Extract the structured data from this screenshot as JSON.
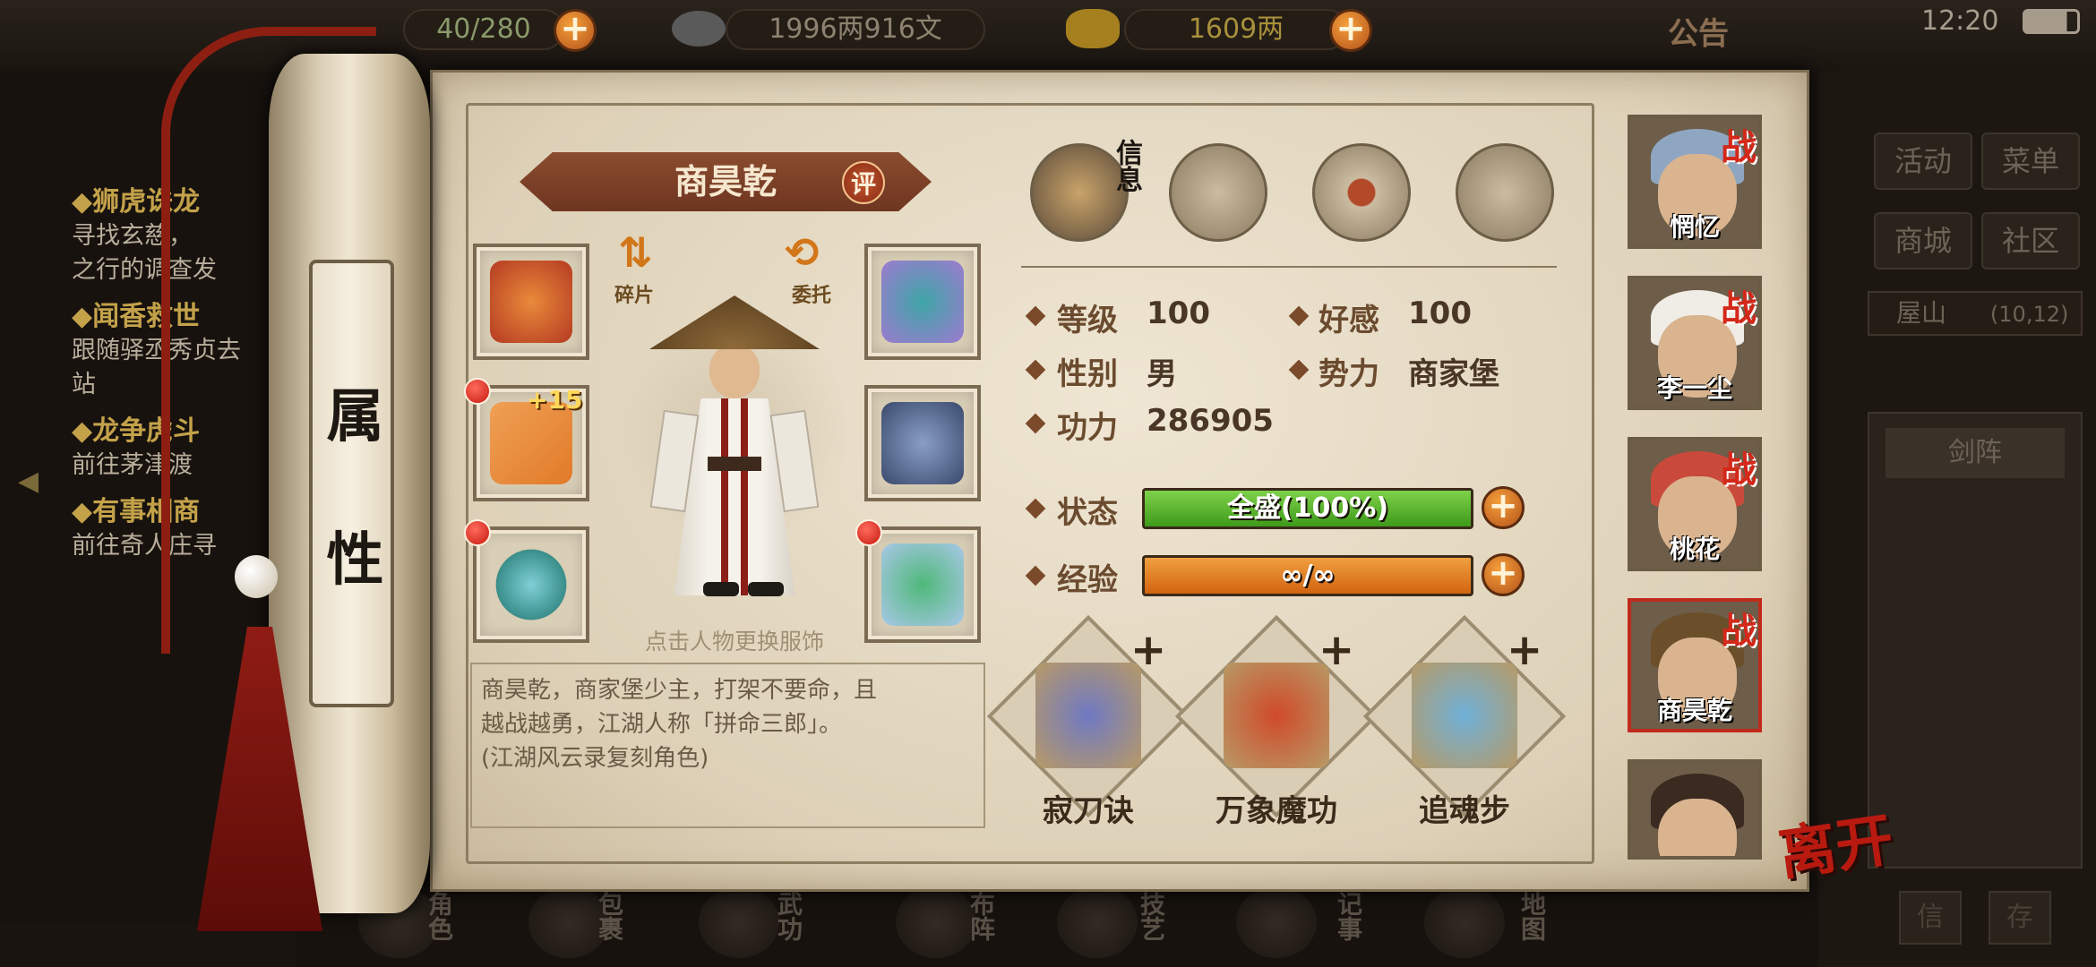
{
  "status_bar": {
    "time": "12:20"
  },
  "top_bar": {
    "resource1": "40/280",
    "silver": "1996两916文",
    "gold": "1609两",
    "notice": "公告"
  },
  "quests": [
    {
      "title": "◆狮虎诛龙",
      "desc": [
        "寻找玄慈，",
        "之行的调查发"
      ]
    },
    {
      "title": "◆闻香救世",
      "desc": [
        "跟随驿丞秀贞去",
        "站"
      ]
    },
    {
      "title": "◆龙争虎斗",
      "desc": [
        "前往茅津渡"
      ]
    },
    {
      "title": "◆有事相商",
      "desc": [
        "前往奇人庄寻"
      ]
    }
  ],
  "right_menu": {
    "activity": "活动",
    "menu": "菜单",
    "shop": "商城",
    "community": "社区",
    "location": "屋山",
    "coords": "(10,12)",
    "formation": "剑阵",
    "info_btn": "信",
    "other_btn": "存"
  },
  "bottom_bar": [
    "角色",
    "包裹",
    "武功",
    "布阵",
    "技艺",
    "记事",
    "地图"
  ],
  "scroll_label": [
    "属",
    "性"
  ],
  "character": {
    "name": "商昊乾",
    "rate_label": "评",
    "fragment_label": "碎片",
    "entrust_label": "委托",
    "weapon_level": "+15",
    "hint": "点击人物更换服饰",
    "description": [
      "商昊乾，商家堡少主，打架不要命，且",
      "越战越勇，江湖人称「拼命三郎」。",
      "(江湖风云录复刻角色)"
    ]
  },
  "info_tab_label": "信息",
  "stats": {
    "level_label": "等级",
    "level": "100",
    "favor_label": "好感",
    "favor": "100",
    "gender_label": "性别",
    "gender": "男",
    "faction_label": "势力",
    "faction": "商家堡",
    "power_label": "功力",
    "power": "286905",
    "status_label": "状态",
    "status_value": "全盛(100%)",
    "status_fraction": 1.0,
    "exp_label": "经验",
    "exp_value": "∞/∞"
  },
  "skills": [
    {
      "name": "寂刀诀"
    },
    {
      "name": "万象魔功"
    },
    {
      "name": "追魂步"
    }
  ],
  "party": [
    {
      "name": "惘忆",
      "tag": "战",
      "hair": "#8fa6c2"
    },
    {
      "name": "李一尘",
      "tag": "战",
      "hair": "#f0ede6"
    },
    {
      "name": "桃花",
      "tag": "战",
      "hair": "#c94a3a"
    },
    {
      "name": "商昊乾",
      "tag": "战",
      "hair": "#6b4f2b"
    },
    {
      "name": "",
      "tag": "",
      "hair": "#3a2a20"
    }
  ],
  "leave_button": "离开",
  "colors": {
    "status_bar": "#5fbf2a",
    "exp_bar": "#e07a12",
    "accent_red": "#c02a1c"
  }
}
